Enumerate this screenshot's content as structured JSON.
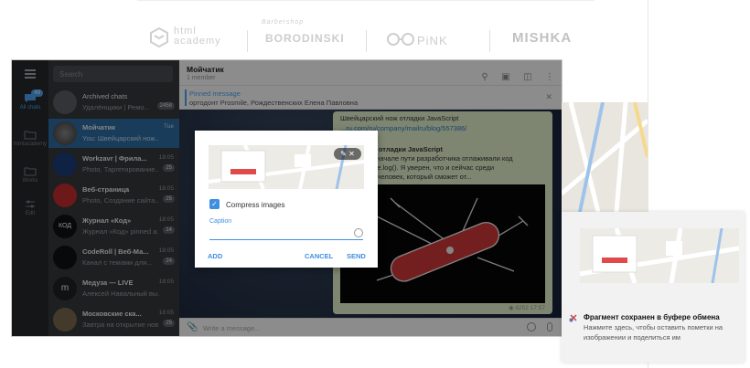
{
  "site": {
    "logos": [
      "html academy",
      "BORODINSKI",
      "PiNK",
      "MISHKA"
    ],
    "borodinski_script": "Barbershop"
  },
  "sidebar": {
    "search_placeholder": "Search",
    "folders": [
      {
        "label": "All chats",
        "badge": "49"
      },
      {
        "label": "htmlacademy",
        "badge": ""
      },
      {
        "label": "Works",
        "badge": ""
      },
      {
        "label": "Edit",
        "badge": ""
      }
    ],
    "chats": [
      {
        "name": "Archived chats",
        "preview": "Удалёнщики | Ремо...",
        "time": "",
        "count": "2458"
      },
      {
        "name": "Мойчатик",
        "preview": "You: Швейцарский нож...",
        "time": "Tue",
        "count": ""
      },
      {
        "name": "Workzavr | Фрила...",
        "preview": "Photo, Таргетирование...",
        "time": "18:05",
        "count": "25"
      },
      {
        "name": "Веб-страница",
        "preview": "Photo, Создание сайта...",
        "time": "18:05",
        "count": "25"
      },
      {
        "name": "Журнал «Код»",
        "preview": "Журнал «Код» pinned a...",
        "time": "18:05",
        "count": "14"
      },
      {
        "name": "CodeRoll | Веб-Ма...",
        "preview": "Канал с темами для...",
        "time": "18:05",
        "count": "24"
      },
      {
        "name": "Медуза — LIVE",
        "preview": "Алексей Навальный вы...",
        "time": "18:05",
        "count": ""
      },
      {
        "name": "Московские ска...",
        "preview": "Завтра на открытие нов...",
        "time": "18:05",
        "count": "25"
      }
    ]
  },
  "chat": {
    "title": "Мойчатик",
    "subtitle": "1 member",
    "pinned_label": "Pinned message",
    "pinned_text": "ортодонт Prosmile, Рождественских Елена Павловна",
    "message_lines": [
      "Швейцарский нож отладки JavaScript",
      "...ru.com/ru/company/mailru/blog/557386/",
      "...ский нож отладки JavaScript",
      "...его все в начале пути разработчика отлаживали код",
      "...щи console.log(). Я уверен, что и сейчас среди",
      "...найдётся человек, который сможет от..."
    ],
    "views": "6252",
    "time": "17:57",
    "compose_placeholder": "Write a message..."
  },
  "dialog": {
    "compress_label": "Compress images",
    "compress_checked": true,
    "caption_label": "Caption",
    "caption_value": "",
    "add": "ADD",
    "cancel": "CANCEL",
    "send": "SEND"
  },
  "notification": {
    "title": "Фрагмент сохранен в буфере обмена",
    "body": "Нажмите здесь, чтобы оставить пометки на изображении и поделиться им"
  },
  "colors": {
    "accent": "#3e8fe0",
    "selected_chat": "#2f6ea5",
    "sidebar": "#35393d"
  }
}
